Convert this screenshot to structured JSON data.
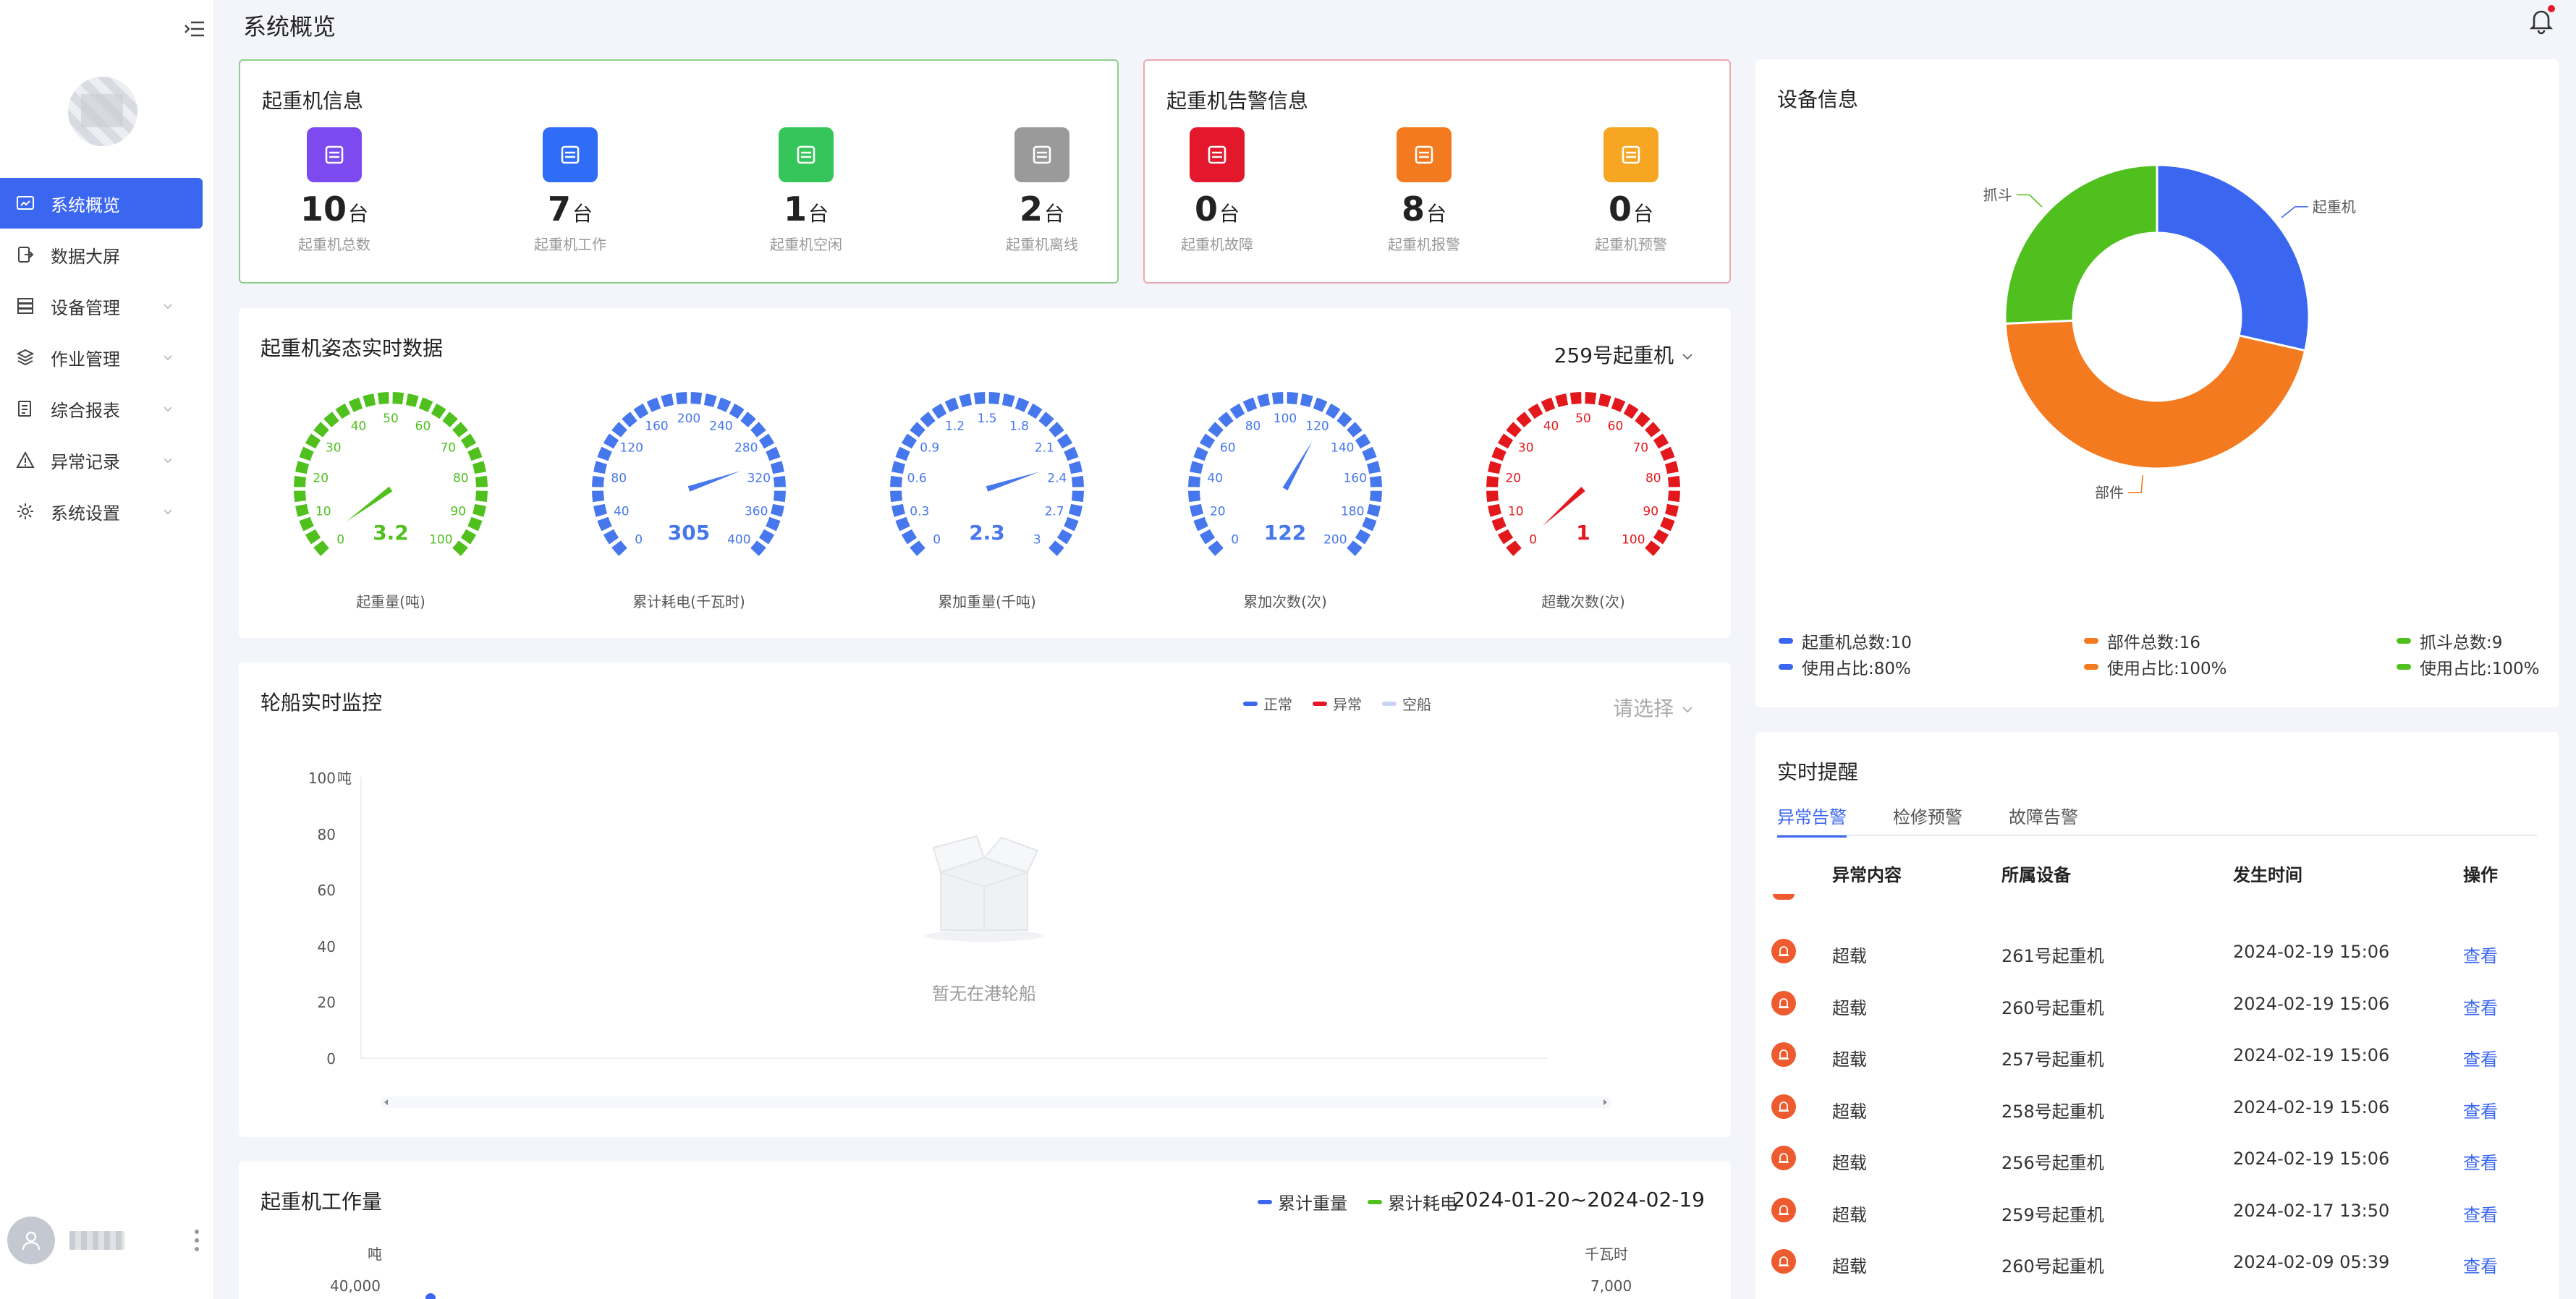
{
  "page": {
    "title": "系统概览"
  },
  "sidebar": {
    "items": [
      {
        "label": "系统概览",
        "icon": "overview-icon",
        "active": true
      },
      {
        "label": "数据大屏",
        "icon": "screen-icon"
      },
      {
        "label": "设备管理",
        "icon": "device-icon"
      },
      {
        "label": "作业管理",
        "icon": "layers-icon"
      },
      {
        "label": "综合报表",
        "icon": "report-icon"
      },
      {
        "label": "异常记录",
        "icon": "warning-icon"
      },
      {
        "label": "系统设置",
        "icon": "gear-icon"
      }
    ]
  },
  "crane_info": {
    "title": "起重机信息",
    "stats": [
      {
        "value": "10",
        "unit": "台",
        "caption": "起重机总数",
        "color": "#7d4af0",
        "icon": "server-icon"
      },
      {
        "value": "7",
        "unit": "台",
        "caption": "起重机工作",
        "color": "#2f6df6",
        "icon": "monitor-icon"
      },
      {
        "value": "1",
        "unit": "台",
        "caption": "起重机空闲",
        "color": "#35c55a",
        "icon": "loading-icon"
      },
      {
        "value": "2",
        "unit": "台",
        "caption": "起重机离线",
        "color": "#9a9a9a",
        "icon": "wifi-off-icon"
      }
    ]
  },
  "alarm_info": {
    "title": "起重机告警信息",
    "stats": [
      {
        "value": "0",
        "unit": "台",
        "caption": "起重机故障",
        "color": "#e3182d",
        "icon": "alert-triangle-icon"
      },
      {
        "value": "8",
        "unit": "台",
        "caption": "起重机报警",
        "color": "#f47a1f",
        "icon": "siren-icon"
      },
      {
        "value": "0",
        "unit": "台",
        "caption": "起重机预警",
        "color": "#f6a623",
        "icon": "bell-warning-icon"
      }
    ]
  },
  "realtime": {
    "title": "起重机姿态实时数据",
    "crane_select": "259号起重机",
    "gauges": [
      {
        "name": "起重量(吨)",
        "value": "3.2",
        "min": 0,
        "max": 100,
        "ticks": [
          "0",
          "10",
          "20",
          "30",
          "40",
          "50",
          "60",
          "70",
          "80",
          "90",
          "100"
        ],
        "color": "#4fc01d"
      },
      {
        "name": "累计耗电(千瓦时)",
        "value": "305",
        "min": 0,
        "max": 400,
        "ticks": [
          "0",
          "40",
          "80",
          "120",
          "160",
          "200",
          "240",
          "280",
          "320",
          "360",
          "400"
        ],
        "color": "#4677ec"
      },
      {
        "name": "累加重量(千吨)",
        "value": "2.3",
        "min": 0,
        "max": 3,
        "ticks": [
          "0",
          "0.3",
          "0.6",
          "0.9",
          "1.2",
          "1.5",
          "1.8",
          "2.1",
          "2.4",
          "2.7",
          "3"
        ],
        "color": "#4677ec"
      },
      {
        "name": "累加次数(次)",
        "value": "122",
        "min": 0,
        "max": 200,
        "ticks": [
          "0",
          "20",
          "40",
          "60",
          "80",
          "100",
          "120",
          "140",
          "160",
          "180",
          "200"
        ],
        "color": "#4677ec"
      },
      {
        "name": "超载次数(次)",
        "value": "1",
        "min": 0,
        "max": 100,
        "ticks": [
          "0",
          "10",
          "20",
          "30",
          "40",
          "50",
          "60",
          "70",
          "80",
          "90",
          "100"
        ],
        "color": "#e3181d"
      }
    ]
  },
  "ship_monitor": {
    "title": "轮船实时监控",
    "select_placeholder": "请选择",
    "legend": [
      {
        "name": "正常",
        "color": "#3a66f0"
      },
      {
        "name": "异常",
        "color": "#e3182d"
      },
      {
        "name": "空船",
        "color": "#c9d3f3"
      }
    ],
    "y_unit": "吨",
    "y_ticks": [
      "0",
      "20",
      "40",
      "60",
      "80",
      "100"
    ],
    "empty_text": "暂无在港轮船"
  },
  "workload": {
    "title": "起重机工作量",
    "legend": [
      {
        "name": "累计重量",
        "color": "#3a66f0"
      },
      {
        "name": "累计耗电",
        "color": "#4fc01d"
      }
    ],
    "date_range": "2024-01-20~2024-02-19",
    "y_left_unit": "吨",
    "y_right_unit": "千瓦时",
    "y_left_top": "40,000",
    "y_right_top": "7,000"
  },
  "chart_data": {
    "type": "pie",
    "title": "设备信息",
    "categories": [
      "起重机",
      "部件",
      "抓斗"
    ],
    "values": [
      10,
      16,
      9
    ],
    "colors": [
      "#3a66f0",
      "#f47a1f",
      "#4fc01d"
    ],
    "legend": [
      {
        "name": "起重机总数:10",
        "sub": "使用占比:80%",
        "color": "#3a66f0"
      },
      {
        "name": "部件总数:16",
        "sub": "使用占比:100%",
        "color": "#f47a1f"
      },
      {
        "name": "抓斗总数:9",
        "sub": "使用占比:100%",
        "color": "#4fc01d"
      }
    ]
  },
  "alerts": {
    "title": "实时提醒",
    "tabs": [
      "异常告警",
      "检修预警",
      "故障告警"
    ],
    "columns": [
      "异常内容",
      "所属设备",
      "发生时间",
      "操作"
    ],
    "rows": [
      {
        "content": "超载",
        "device": "261号起重机",
        "time": "2024-02-19 15:06",
        "action": "查看"
      },
      {
        "content": "超载",
        "device": "260号起重机",
        "time": "2024-02-19 15:06",
        "action": "查看"
      },
      {
        "content": "超载",
        "device": "257号起重机",
        "time": "2024-02-19 15:06",
        "action": "查看"
      },
      {
        "content": "超载",
        "device": "258号起重机",
        "time": "2024-02-19 15:06",
        "action": "查看"
      },
      {
        "content": "超载",
        "device": "256号起重机",
        "time": "2024-02-19 15:06",
        "action": "查看"
      },
      {
        "content": "超载",
        "device": "259号起重机",
        "time": "2024-02-17 13:50",
        "action": "查看"
      },
      {
        "content": "超载",
        "device": "260号起重机",
        "time": "2024-02-09 05:39",
        "action": "查看"
      }
    ]
  }
}
